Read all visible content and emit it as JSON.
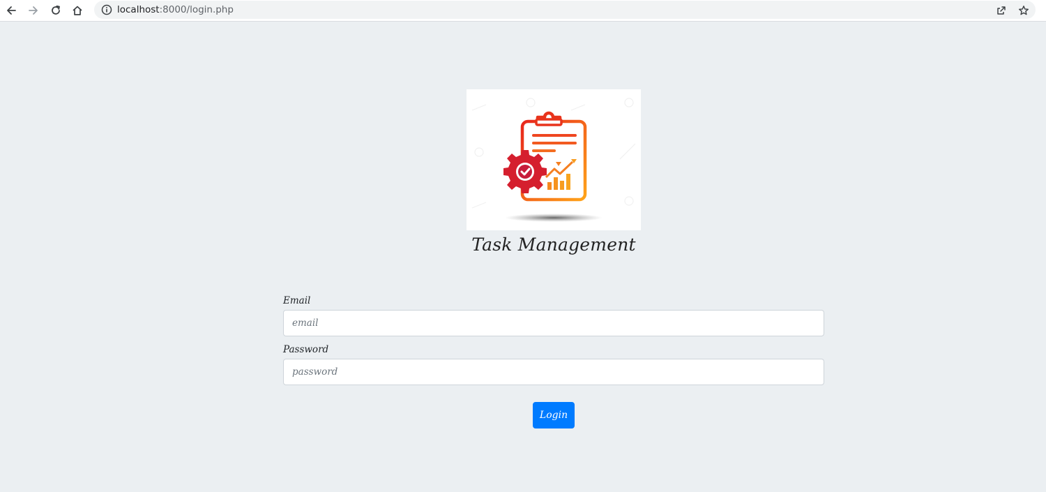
{
  "browser": {
    "url_host": "localhost",
    "url_path": ":8000/login.php"
  },
  "app": {
    "title": "Task Management"
  },
  "form": {
    "email_label": "Email",
    "email_placeholder": "email",
    "password_label": "Password",
    "password_placeholder": "password",
    "login_label": "Login"
  },
  "colors": {
    "primary": "#007bff",
    "page_background": "#ebeff2"
  }
}
